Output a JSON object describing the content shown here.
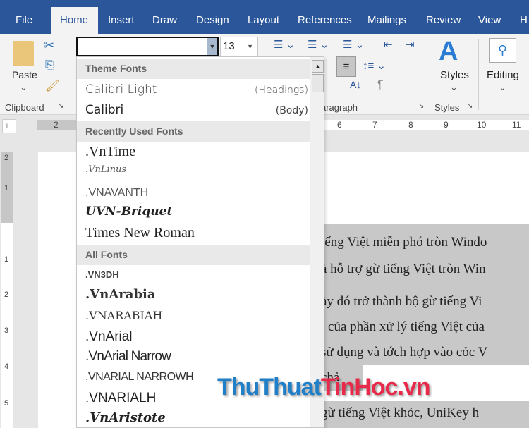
{
  "tabs": [
    "File",
    "Home",
    "Insert",
    "Draw",
    "Design",
    "Layout",
    "References",
    "Mailings",
    "Review",
    "View",
    "H"
  ],
  "active_tab": "Home",
  "ribbon": {
    "clipboard": {
      "paste": "Paste",
      "group": "Clipboard"
    },
    "font_name": "",
    "font_size": "13",
    "paragraph_group": "aragraph",
    "styles": {
      "label": "Styles",
      "group": "Styles"
    },
    "editing": "Editing"
  },
  "ruler": {
    "h_ticks": [
      "2",
      "6",
      "7",
      "8",
      "9",
      "10",
      "11"
    ],
    "v_ticks": [
      "2",
      "1",
      "1",
      "2",
      "3",
      "4",
      "5"
    ]
  },
  "font_dropdown": {
    "theme_header": "Theme Fonts",
    "theme_fonts": [
      {
        "name": "Calibri Light",
        "tag": "(Headings)"
      },
      {
        "name": "Calibri",
        "tag": "(Body)"
      }
    ],
    "recent_header": "Recently Used Fonts",
    "recent_fonts": [
      ".VnTime",
      ".VnLinus",
      ".VNAVANTH",
      "UVN-Briquet",
      "Times New Roman"
    ],
    "all_header": "All Fonts",
    "all_fonts": [
      ".VN3DH",
      ".VnArabia",
      ".VNARABIAH",
      ".VnArial",
      ".VnArial Narrow",
      ".VNARIAL NARROWH",
      ".VNARIALH",
      ".VnAristote"
    ]
  },
  "document": {
    "lines": [
      "iếng Việt miễn phó tròn Windo",
      "à hỗ trợ gừ tiếng Việt tròn Win",
      "ày đó trở thành bộ gừ tiếng Vi",
      "ı của phần xử lý tiếng Việt của",
      "sử dụng và tớch hợp vào cỏc V",
      "chả",
      "gừ tiếng Việt khỏc, UniKey h"
    ]
  },
  "watermark": {
    "part1": "ThuThuat",
    "part2": "TinHoc.vn",
    "color1": "#1f7fc8",
    "color2": "#e8294a"
  },
  "colors": {
    "titlebar": "#2b579a",
    "ribbon": "#f3f3f3",
    "selection": "#c8c8c8"
  }
}
